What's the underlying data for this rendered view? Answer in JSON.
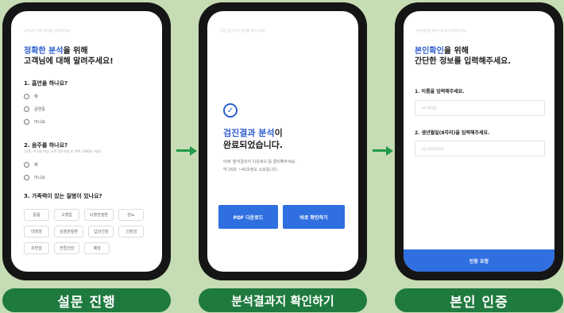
{
  "screen1": {
    "top_hint": "고객님의 건강 정보를 입력해주세요",
    "title_highlight": "정확한 분석",
    "title_rest": "을 위해",
    "title_line2": "고객님에 대해 알려주세요!",
    "q1": {
      "label": "1. 흡연을 하나요?",
      "options": [
        "예",
        "금연중",
        "아니요"
      ]
    },
    "q2": {
      "label": "2. 음주를 하나요?",
      "sub": "(기준: 주 1회 이상, 소주 1병 이상 or 맥주 1000cc 이상)",
      "options": [
        "예",
        "아니요"
      ]
    },
    "q3": {
      "label": "3. 가족력이 있는 질병이 있나요?",
      "chips": [
        "없음",
        "고혈압",
        "뇌혈관질환",
        "당뇨",
        "대장암",
        "심혈관질환",
        "갑상선암",
        "신장암",
        "유방암",
        "전립선암",
        "폐암"
      ]
    }
  },
  "screen2": {
    "top_hint": "건강 검진 분석 결과를 확인하세요",
    "title_highlight": "검진결과 분석",
    "title_rest": "이",
    "title_line2": "완료되었습니다.",
    "desc_line1": "아래 '분석결과지 다운로드'를 클릭해주세요.",
    "desc_line2": "약 20초 ~40초정도 소요됩니다.",
    "btn_pdf": "PDF 다운로드",
    "btn_view": "바로 확인하기"
  },
  "screen3": {
    "top_hint": "본인확인을 위한 정보를 입력해주세요",
    "title_highlight": "본인확인",
    "title_rest": "을 위해",
    "title_line2": "간단한 정보를 입력해주세요.",
    "q1_label": "1. 이름을 입력해주세요.",
    "q1_placeholder": "ex) 홍길동",
    "q2_label": "2. 생년월일(8자리)을 입력해주세요.",
    "q2_placeholder": "ex) 20230515",
    "auth_button": "인증 요청"
  },
  "labels": {
    "step1": "설문 진행",
    "step2": "분석결과지 확인하기",
    "step3": "본인 인증"
  },
  "colors": {
    "background": "#c6dcb4",
    "pill": "#1f7a3f",
    "arrow": "#1f9a4a",
    "accent_blue": "#2f6fe0"
  }
}
